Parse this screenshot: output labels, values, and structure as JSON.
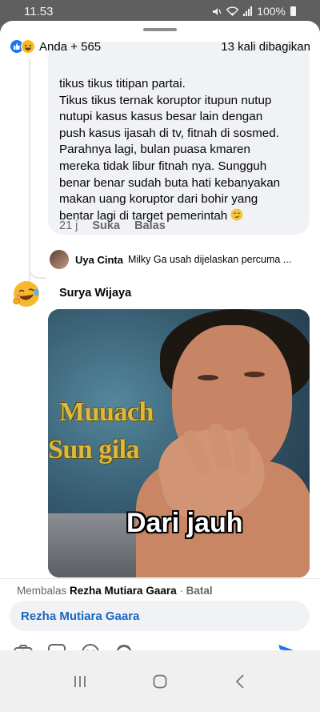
{
  "status_bar": {
    "time": "11.53",
    "battery": "100%"
  },
  "reactions": {
    "summary": "Anda + 565",
    "shares": "13 kali dibagikan",
    "icons": [
      "like-icon",
      "haha-icon"
    ]
  },
  "comment": {
    "lines": [
      "tikus tikus titipan partai.",
      "Tikus tikus ternak koruptor itupun nutup",
      "nutupi kasus kasus besar lain dengan",
      "push kasus ijasah di tv, fitnah di sosmed.",
      "Parahnya lagi, bulan puasa kmaren",
      "mereka tidak libur fitnah nya. Sungguh",
      "benar benar sudah buta hati kebanyakan",
      "makan uang koruptor dari bohir yang",
      "bentar lagi di target pemerintah"
    ],
    "time": "21 j",
    "like_label": "Suka",
    "reply_label": "Balas"
  },
  "reply_preview": {
    "name": "Uya Cinta",
    "text": "Milky Ga usah dijelaskan percuma ..."
  },
  "second_comment": {
    "name": "Surya Wijaya",
    "meme_text_1": "Muuach",
    "meme_text_2": "Sun gila",
    "meme_text_3": "Dari jauh"
  },
  "composer": {
    "replying_prefix": "Membalas",
    "replying_to": "Rezha Mutiara Gaara",
    "separator": " · ",
    "cancel_label": "Batal",
    "input_value": "Rezha Mutiara Gaara",
    "tools": [
      "camera-icon",
      "gif-icon",
      "emoji-icon",
      "avatar-sticker-icon"
    ]
  },
  "colors": {
    "accent": "#1877f2",
    "mention": "#1a66c2",
    "muted": "#65676b",
    "bubble": "#f0f2f5"
  }
}
